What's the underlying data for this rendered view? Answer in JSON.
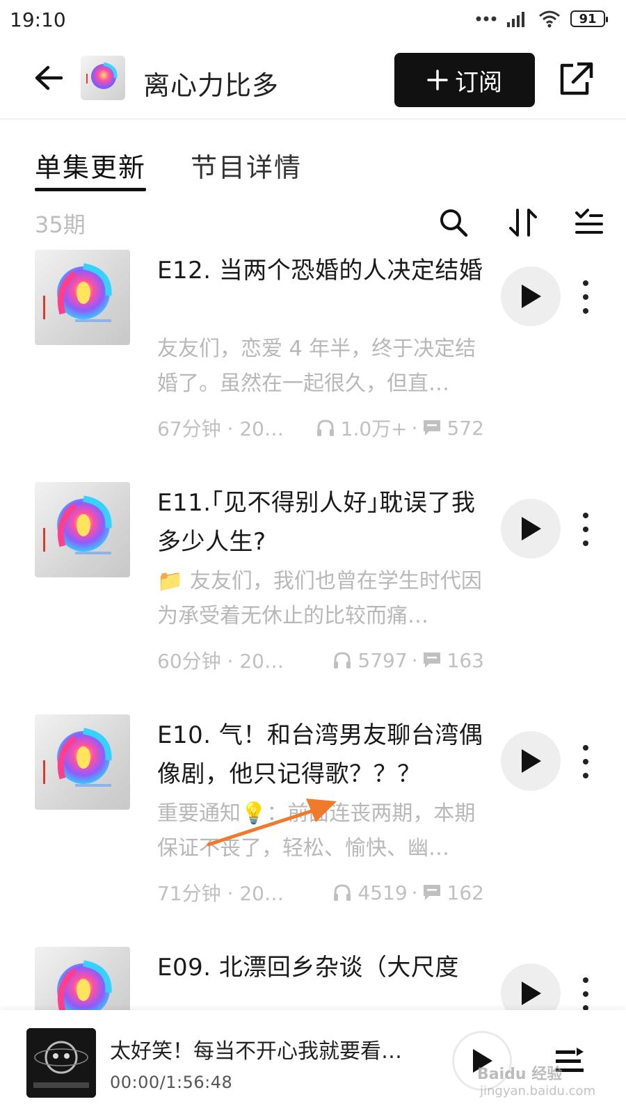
{
  "status_bar": {
    "time": "19:10",
    "battery": "91"
  },
  "header": {
    "title": "离心力比多",
    "subscribe_label": "订阅"
  },
  "tabs": [
    {
      "label": "单集更新",
      "active": true
    },
    {
      "label": "节目详情",
      "active": false
    }
  ],
  "list": {
    "count_label": "35期",
    "episodes": [
      {
        "title": "E12. 当两个恐婚的人决定结婚",
        "desc": "友友们，恋爱 4 年半，终于决定结婚了。虽然在一起很久，但直…",
        "duration": "67分钟 · 2022…",
        "plays": "1.0万+",
        "comments": "572"
      },
      {
        "title": "E11.｢见不得别人好｣耽误了我多少人生?",
        "desc": "📁 友友们，我们也曾在学生时代因为承受着无休止的比较而痛…",
        "duration": "60分钟 · 2022/…",
        "plays": "5797",
        "comments": "163"
      },
      {
        "title": "E10. 气！和台湾男友聊台湾偶像剧，他只记得歌？？？",
        "desc": "重要通知💡：前面连丧两期，本期保证不丧了，轻松、愉快、幽…",
        "duration": "71分钟 · 2022/…",
        "plays": "4519",
        "comments": "162"
      },
      {
        "title": "E09. 北漂回乡杂谈（大尺度",
        "desc": "",
        "duration": "",
        "plays": "",
        "comments": ""
      }
    ]
  },
  "player": {
    "title": "太好笑！每当不开心我就要看…",
    "time": "00:00/1:56:48"
  },
  "watermark": {
    "brand": "Baidu 经验",
    "url": "jingyan.baidu.com"
  },
  "colors": {
    "accent": "#111111",
    "muted_text": "#b8b8b8",
    "annotation_arrow": "#f07a2b"
  }
}
